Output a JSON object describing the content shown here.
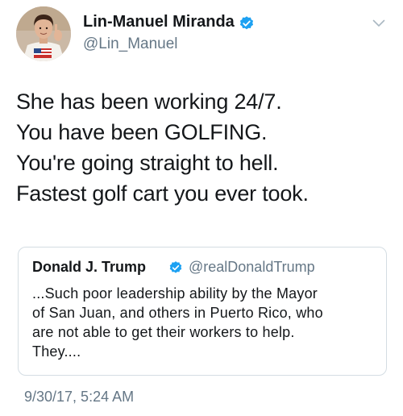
{
  "author": {
    "name": "Lin-Manuel Miranda",
    "handle": "@Lin_Manuel",
    "verified": true
  },
  "tweet": {
    "lines": [
      "She has been working 24/7.",
      "You have been GOLFING.",
      "You're going straight to hell.",
      "Fastest golf cart you ever took."
    ],
    "timestamp": "9/30/17, 5:24 AM"
  },
  "quoted_tweet": {
    "author_name": "Donald J. Trump",
    "author_handle": "@realDonaldTrump",
    "verified": true,
    "lines": [
      "...Such poor leadership ability by the Mayor",
      "of San Juan, and others in Puerto Rico, who",
      "are not able to get their workers to help.",
      "They...."
    ]
  },
  "icons": {
    "verified": "verified-badge-icon",
    "menu": "chevron-down-icon"
  },
  "colors": {
    "verified_blue": "#1da1f2",
    "secondary_text": "#657786",
    "primary_text": "#14171a",
    "border": "#d4dde3"
  }
}
